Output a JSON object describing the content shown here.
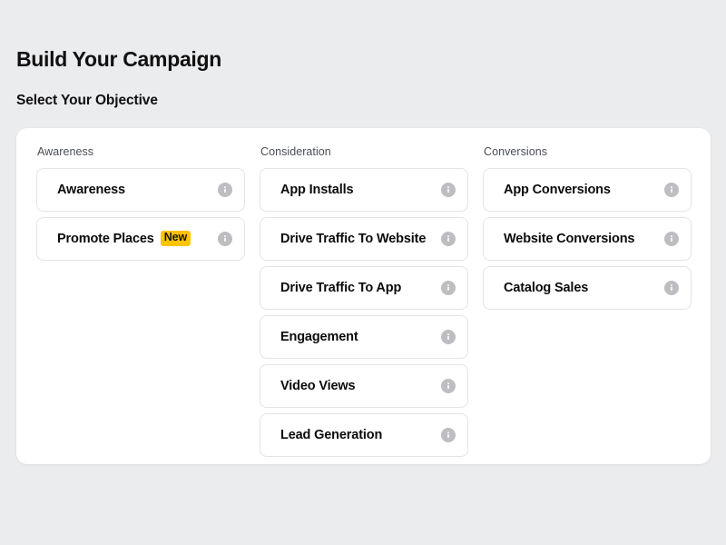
{
  "header": {
    "title": "Build Your Campaign",
    "subtitle": "Select Your Objective"
  },
  "colors": {
    "page_background": "#ebecee",
    "card_background": "#ffffff",
    "button_border": "#e3e4e6",
    "badge_new_background": "#ffc400",
    "badge_new_text": "#141414",
    "info_icon": "#bcbec1",
    "column_header_text": "#4a4f55",
    "label_text": "#0b0b0b"
  },
  "columns": [
    {
      "header": "Awareness",
      "options": [
        {
          "label": "Awareness",
          "badge": null,
          "info_icon": "info-icon"
        },
        {
          "label": "Promote Places",
          "badge": "New",
          "info_icon": "info-icon"
        }
      ]
    },
    {
      "header": "Consideration",
      "options": [
        {
          "label": "App Installs",
          "badge": null,
          "info_icon": "info-icon"
        },
        {
          "label": "Drive Traffic To Website",
          "badge": null,
          "info_icon": "info-icon"
        },
        {
          "label": "Drive Traffic To App",
          "badge": null,
          "info_icon": "info-icon"
        },
        {
          "label": "Engagement",
          "badge": null,
          "info_icon": "info-icon"
        },
        {
          "label": "Video Views",
          "badge": null,
          "info_icon": "info-icon"
        },
        {
          "label": "Lead Generation",
          "badge": null,
          "info_icon": "info-icon"
        }
      ]
    },
    {
      "header": "Conversions",
      "options": [
        {
          "label": "App Conversions",
          "badge": null,
          "info_icon": "info-icon"
        },
        {
          "label": "Website Conversions",
          "badge": null,
          "info_icon": "info-icon"
        },
        {
          "label": "Catalog Sales",
          "badge": null,
          "info_icon": "info-icon"
        }
      ]
    }
  ]
}
